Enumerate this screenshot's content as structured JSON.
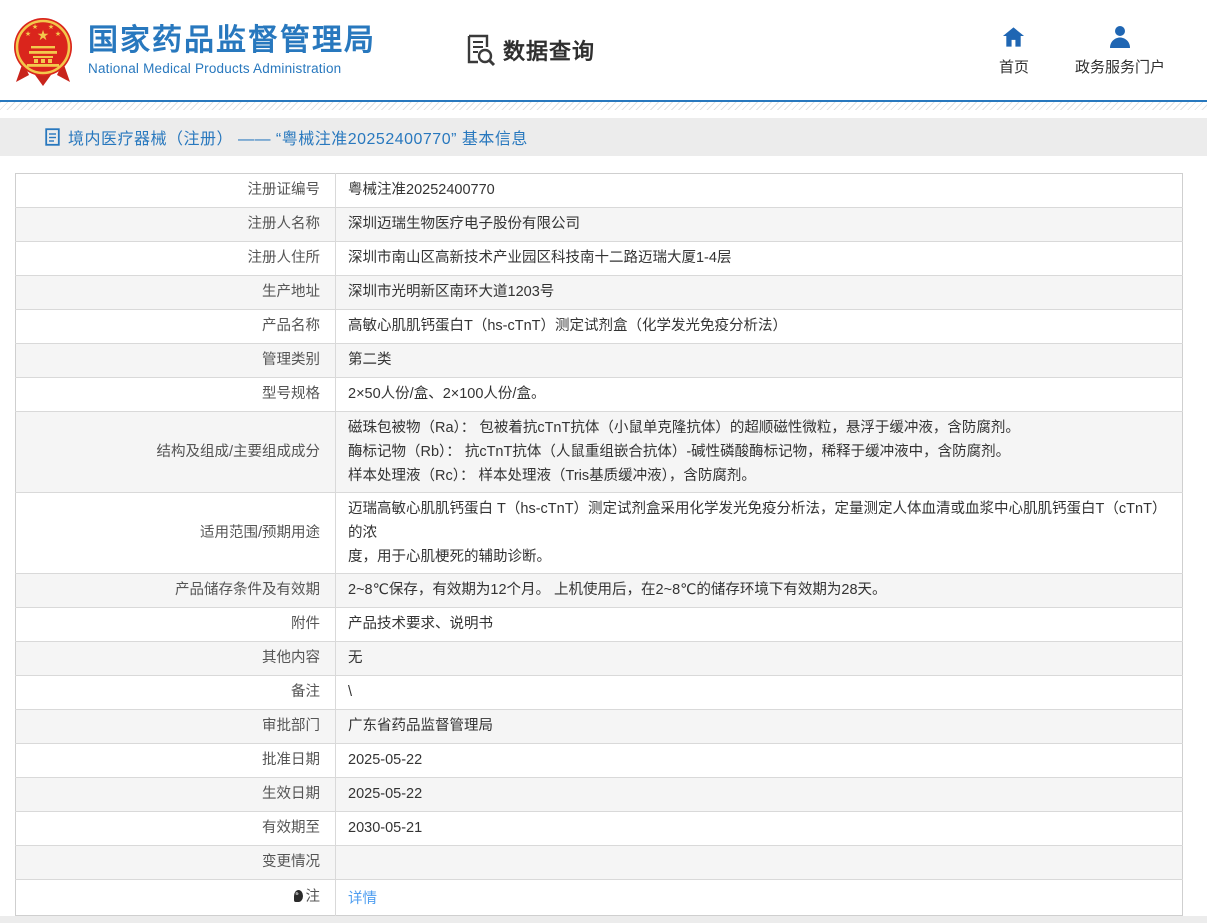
{
  "colors": {
    "brand-blue": "#2878be",
    "icon-blue": "#1f66b3",
    "link-blue": "#4f9ef0"
  },
  "header": {
    "org_name_cn": "国家药品监督管理局",
    "org_name_en": "National Medical Products Administration",
    "section_title": "数据查询",
    "nav": [
      {
        "label": "首页",
        "icon": "home-icon"
      },
      {
        "label": "政务服务门户",
        "icon": "user-icon"
      }
    ]
  },
  "breadcrumb": {
    "text": "境内医疗器械（注册） —— “粤械注准20252400770” 基本信息"
  },
  "table": {
    "rows": [
      {
        "label": "注册证编号",
        "value": "粤械注准20252400770"
      },
      {
        "label": "注册人名称",
        "value": "深圳迈瑞生物医疗电子股份有限公司"
      },
      {
        "label": "注册人住所",
        "value": "深圳市南山区高新技术产业园区科技南十二路迈瑞大厦1-4层"
      },
      {
        "label": "生产地址",
        "value": "深圳市光明新区南环大道1203号"
      },
      {
        "label": "产品名称",
        "value": "高敏心肌肌钙蛋白T（hs-cTnT）测定试剂盒（化学发光免疫分析法）"
      },
      {
        "label": "管理类别",
        "value": "第二类"
      },
      {
        "label": "型号规格",
        "value": "2×50人份/盒、2×100人份/盒。"
      },
      {
        "label": "结构及组成/主要组成成分",
        "lines": [
          "磁珠包被物（Ra）： 包被着抗cTnT抗体（小鼠单克隆抗体）的超顺磁性微粒，悬浮于缓冲液，含防腐剂。",
          "酶标记物（Rb）： 抗cTnT抗体（人鼠重组嵌合抗体）-碱性磷酸酶标记物，稀释于缓冲液中，含防腐剂。",
          "样本处理液（Rc）： 样本处理液（Tris基质缓冲液），含防腐剂。"
        ]
      },
      {
        "label": "适用范围/预期用途",
        "lines": [
          "迈瑞高敏心肌肌钙蛋白 T（hs-cTnT）测定试剂盒采用化学发光免疫分析法，定量测定人体血清或血浆中心肌肌钙蛋白T（cTnT）的浓",
          "度，用于心肌梗死的辅助诊断。"
        ]
      },
      {
        "label": "产品储存条件及有效期",
        "value": "2~8℃保存，有效期为12个月。 上机使用后，在2~8℃的储存环境下有效期为28天。"
      },
      {
        "label": "附件",
        "value": "产品技术要求、说明书"
      },
      {
        "label": "其他内容",
        "value": "无"
      },
      {
        "label": "备注",
        "value": "\\"
      },
      {
        "label": "审批部门",
        "value": "广东省药品监督管理局"
      },
      {
        "label": "批准日期",
        "value": "2025-05-22"
      },
      {
        "label": "生效日期",
        "value": "2025-05-22"
      },
      {
        "label": "有效期至",
        "value": "2030-05-21"
      },
      {
        "label": "变更情况",
        "value": ""
      },
      {
        "label": "注",
        "icon": "note-icon",
        "value": "详情",
        "link": true
      }
    ]
  }
}
